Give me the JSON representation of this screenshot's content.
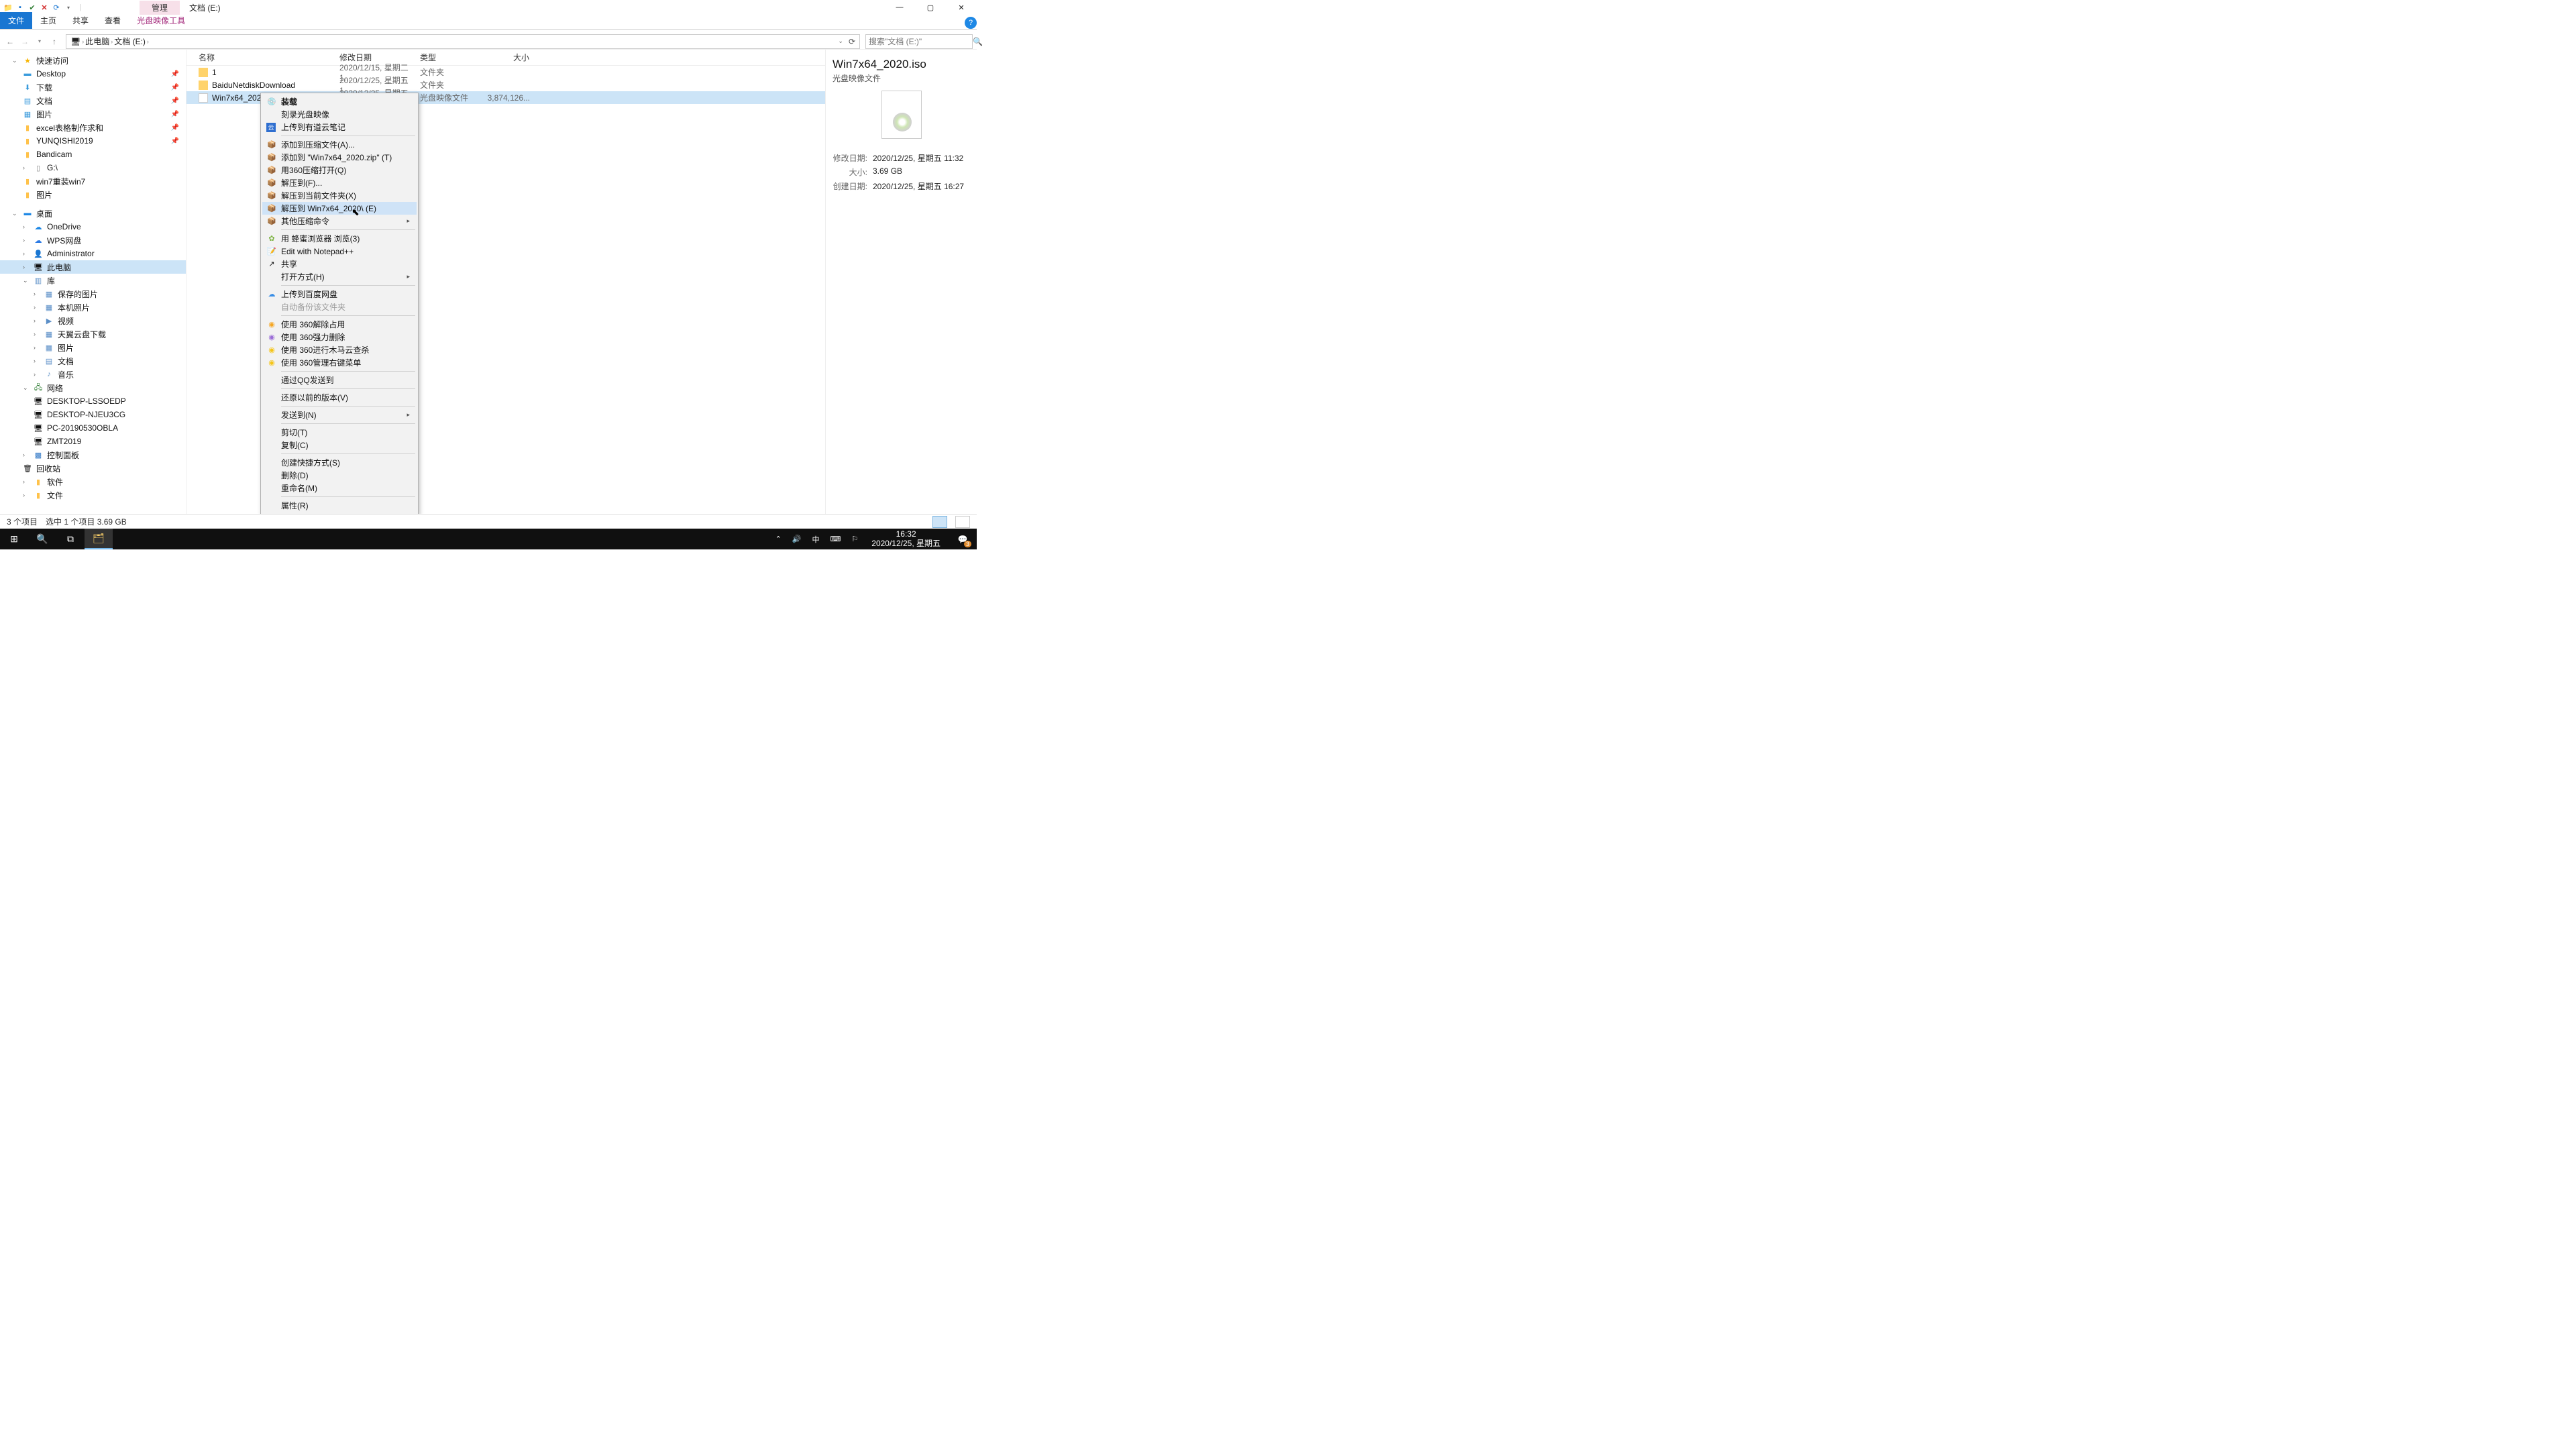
{
  "window": {
    "tab_mgmt": "管理",
    "title": "文档 (E:)"
  },
  "ribbon": {
    "file": "文件",
    "home": "主页",
    "share": "共享",
    "view": "查看",
    "iso": "光盘映像工具"
  },
  "breadcrumb": {
    "root": "此电脑",
    "loc": "文档 (E:)"
  },
  "search": {
    "placeholder": "搜索\"文档 (E:)\""
  },
  "columns": {
    "name": "名称",
    "date": "修改日期",
    "type": "类型",
    "size": "大小"
  },
  "rows": [
    {
      "name": "1",
      "date": "2020/12/15, 星期二 1...",
      "type": "文件夹",
      "size": ""
    },
    {
      "name": "BaiduNetdiskDownload",
      "date": "2020/12/25, 星期五 1...",
      "type": "文件夹",
      "size": ""
    },
    {
      "name": "Win7x64_2020.iso",
      "date": "2020/12/25, 星期五 1...",
      "type": "光盘映像文件",
      "size": "3,874,126..."
    }
  ],
  "tree": {
    "quick": "快速访问",
    "q": [
      "Desktop",
      "下载",
      "文档",
      "图片",
      "excel表格制作求和",
      "YUNQISHI2019",
      "Bandicam",
      "G:\\",
      "win7重装win7",
      "图片"
    ],
    "desktop": "桌面",
    "d": [
      "OneDrive",
      "WPS网盘",
      "Administrator",
      "此电脑",
      "库",
      "保存的图片",
      "本机照片",
      "视频",
      "天翼云盘下载",
      "图片",
      "文档",
      "音乐",
      "网络",
      "DESKTOP-LSSOEDP",
      "DESKTOP-NJEU3CG",
      "PC-20190530OBLA",
      "ZMT2019",
      "控制面板",
      "回收站",
      "软件",
      "文件"
    ]
  },
  "ctx": {
    "mount": "装载",
    "burn": "刻录光盘映像",
    "youdao": "上传到有道云笔记",
    "addarchive": "添加到压缩文件(A)...",
    "addzip": "添加到 \"Win7x64_2020.zip\" (T)",
    "open360": "用360压缩打开(Q)",
    "extractto": "解压到(F)...",
    "extracthere": "解压到当前文件夹(X)",
    "extractnamed": "解压到 Win7x64_2020\\ (E)",
    "otherzip": "其他压缩命令",
    "bee": "用 蜂蜜浏览器 浏览(3)",
    "npp": "Edit with Notepad++",
    "share": "共享",
    "openwith": "打开方式(H)",
    "baidu": "上传到百度网盘",
    "autobak": "自动备份该文件夹",
    "unlock360": "使用 360解除占用",
    "forcedel360": "使用 360强力删除",
    "scan360": "使用 360进行木马云查杀",
    "mgr360": "使用 360管理右键菜单",
    "qqsend": "通过QQ发送到",
    "restore": "还原以前的版本(V)",
    "sendto": "发送到(N)",
    "cut": "剪切(T)",
    "copy": "复制(C)",
    "shortcut": "创建快捷方式(S)",
    "delete": "删除(D)",
    "rename": "重命名(M)",
    "props": "属性(R)"
  },
  "details": {
    "name": "Win7x64_2020.iso",
    "type": "光盘映像文件",
    "k_mod": "修改日期:",
    "v_mod": "2020/12/25, 星期五 11:32",
    "k_size": "大小:",
    "v_size": "3.69 GB",
    "k_create": "创建日期:",
    "v_create": "2020/12/25, 星期五 16:27"
  },
  "status": {
    "count": "3 个项目",
    "sel": "选中 1 个项目  3.69 GB"
  },
  "taskbar": {
    "ime": "中",
    "time": "16:32",
    "date": "2020/12/25, 星期五",
    "badge": "3"
  }
}
